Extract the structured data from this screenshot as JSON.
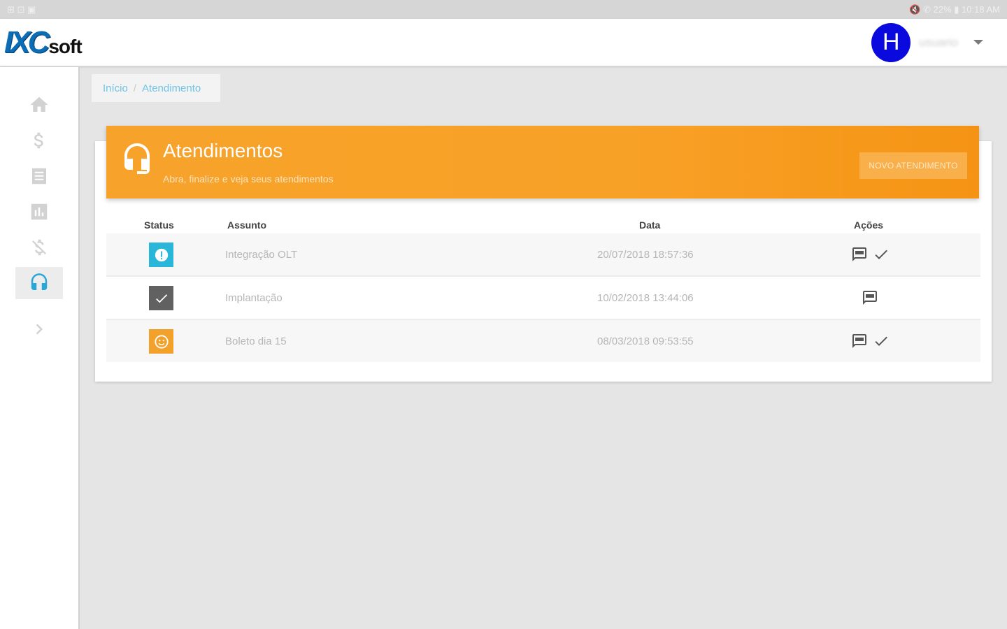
{
  "statusbar": {
    "left": "⊞ ⊡ ▣",
    "right": "🔇 ✆ 22% ▮ 10:18 AM"
  },
  "header": {
    "logo_ixc": "IXC",
    "logo_soft": "soft",
    "avatar_letter": "H",
    "username": "usuario"
  },
  "breadcrumb": {
    "home": "Início",
    "separator": "/",
    "current": "Atendimento"
  },
  "banner": {
    "title": "Atendimentos",
    "subtitle": "Abra, finalize e veja seus atendimentos",
    "new_button": "NOVO ATENDIMENTO"
  },
  "table": {
    "headers": {
      "status": "Status",
      "assunto": "Assunto",
      "data": "Data",
      "acoes": "Ações"
    },
    "rows": [
      {
        "status": "open",
        "assunto": "Integração OLT",
        "data": "20/07/2018 18:57:36",
        "actions": [
          "comment",
          "check"
        ]
      },
      {
        "status": "done",
        "assunto": "Implantação",
        "data": "10/02/2018 13:44:06",
        "actions": [
          "comment"
        ]
      },
      {
        "status": "waiting",
        "assunto": "Boleto dia 15",
        "data": "08/03/2018 09:53:55",
        "actions": [
          "comment",
          "check"
        ]
      }
    ]
  },
  "colors": {
    "accent_orange": "#f7a22a",
    "active_blue": "#29a8d6",
    "status_open": "#29b6d8",
    "status_done": "#616161",
    "status_waiting": "#f2a12a",
    "avatar_blue": "#0a0adf"
  },
  "icons": {
    "sidebar": [
      "home-icon",
      "dollar-icon",
      "document-icon",
      "chart-icon",
      "no-dollar-icon",
      "headset-icon",
      "chevron-right-icon"
    ]
  }
}
